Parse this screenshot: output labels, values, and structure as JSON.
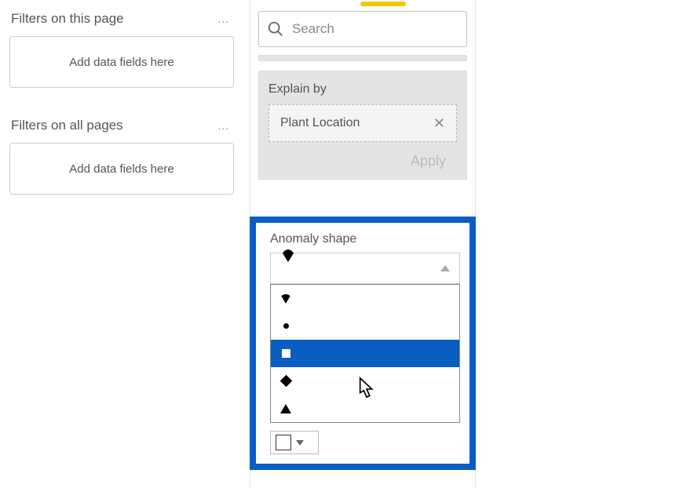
{
  "filters_panel": {
    "page_header": "Filters on this page",
    "page_drop": "Add data fields here",
    "all_header": "Filters on all pages",
    "all_drop": "Add data fields here",
    "ellipsis": "..."
  },
  "search": {
    "placeholder": "Search"
  },
  "explain": {
    "label": "Explain by",
    "chip_label": "Plant Location",
    "apply": "Apply"
  },
  "shape": {
    "title": "Anomaly shape",
    "selected": "drop",
    "options": [
      {
        "name": "drop",
        "label": "Drop"
      },
      {
        "name": "dot",
        "label": "Dot"
      },
      {
        "name": "square",
        "label": "Square"
      },
      {
        "name": "diamond",
        "label": "Diamond"
      },
      {
        "name": "triangle",
        "label": "Triangle"
      }
    ]
  }
}
